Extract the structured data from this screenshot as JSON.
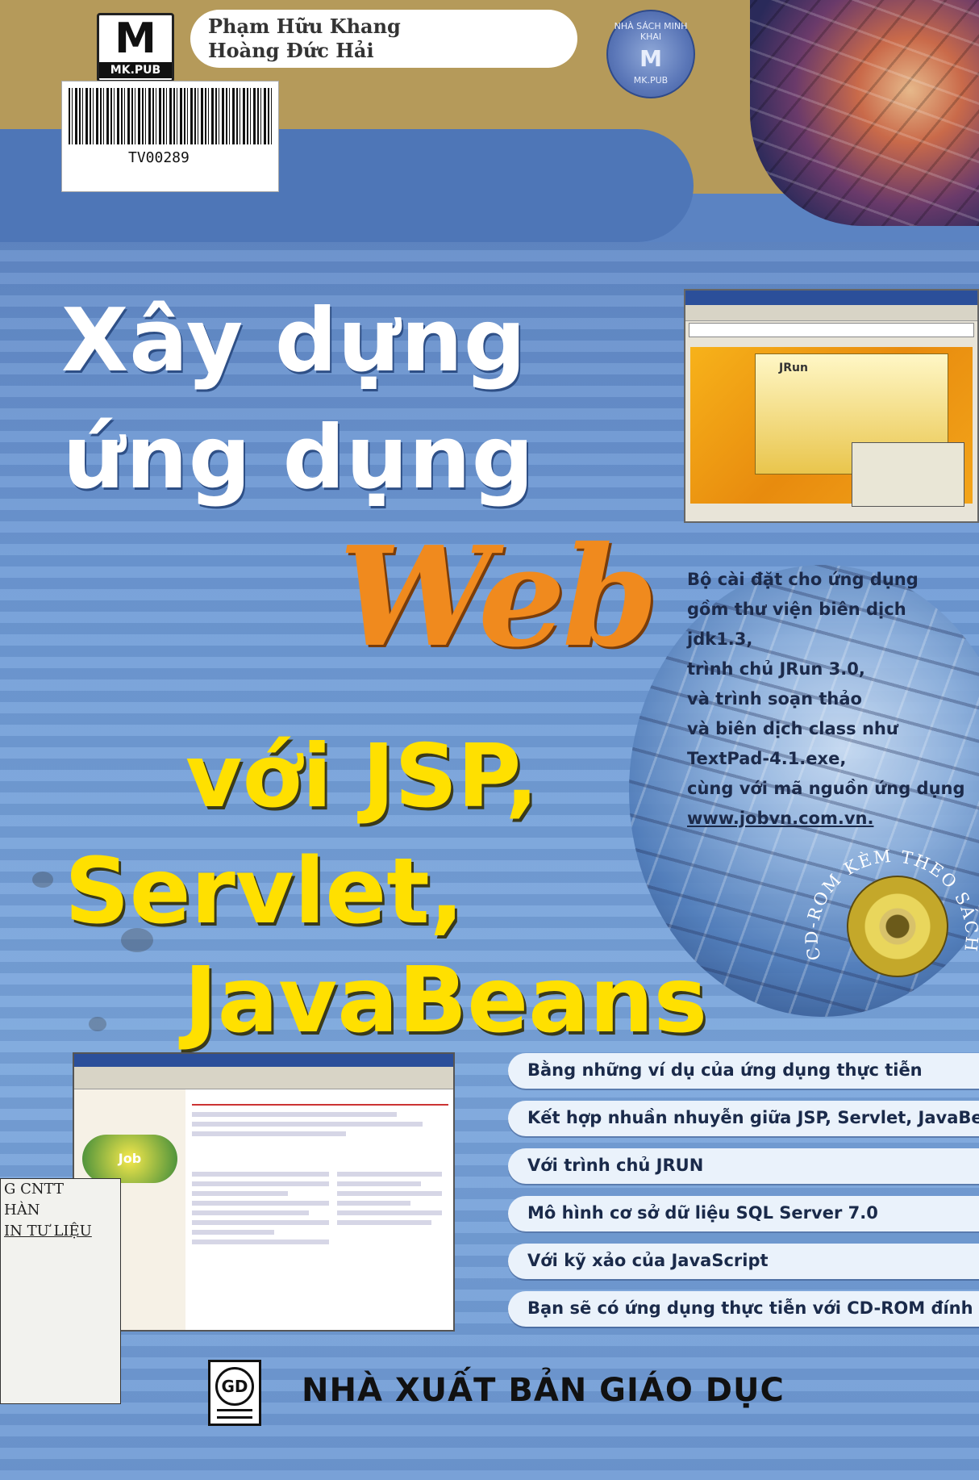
{
  "publisher_logo": {
    "letter": "M",
    "label": "MK.PUB"
  },
  "authors": [
    "Phạm Hữu Khang",
    "Hoàng Đức Hải"
  ],
  "seal": {
    "top": "NHÀ SÁCH MINH KHAI",
    "center": "M",
    "bottom": "MK.PUB"
  },
  "barcode": {
    "code": "TV00289"
  },
  "title": {
    "line1": "Xây dựng",
    "line2": "ứng dụng",
    "web": "Web",
    "line3": "với JSP,",
    "line4": "Servlet,",
    "line5": "JavaBeans"
  },
  "blurb": {
    "lines": [
      "Bộ cài đặt cho ứng dụng",
      "gồm thư viện biên dịch jdk1.3,",
      "trình chủ JRun 3.0,",
      "và trình soạn thảo",
      "và biên dịch class như",
      "TextPad-4.1.exe,",
      "cùng với mã nguồn ứng dụng"
    ],
    "link": "www.jobvn.com.vn."
  },
  "cd_label": "CD-ROM KÈM THEO SÁCH",
  "screenshot_top": {
    "brand": "JRun"
  },
  "screenshot_bottom": {
    "badge": "Job"
  },
  "stamp": [
    "G CNTT",
    "HÀN",
    "IN TƯ LIỆU"
  ],
  "features": [
    "Bằng những ví dụ của ứng dụng thực tiễn",
    "Kết hợp nhuần nhuyễn giữa JSP, Servlet, JavaBeans",
    "Với trình chủ JRUN",
    "Mô hình cơ sở dữ liệu SQL Server 7.0",
    "Với kỹ xảo của JavaScript",
    "Bạn sẽ có ứng dụng thực tiễn với CD-ROM đính kèm"
  ],
  "publisher": {
    "logo_text": "GD",
    "name": "NHÀ XUẤT BẢN GIÁO DỤC"
  },
  "colors": {
    "top_band": "#b59a5a",
    "blue": "#6f9bd6",
    "web_orange": "#f08a1e",
    "title_yellow": "#ffe000"
  }
}
